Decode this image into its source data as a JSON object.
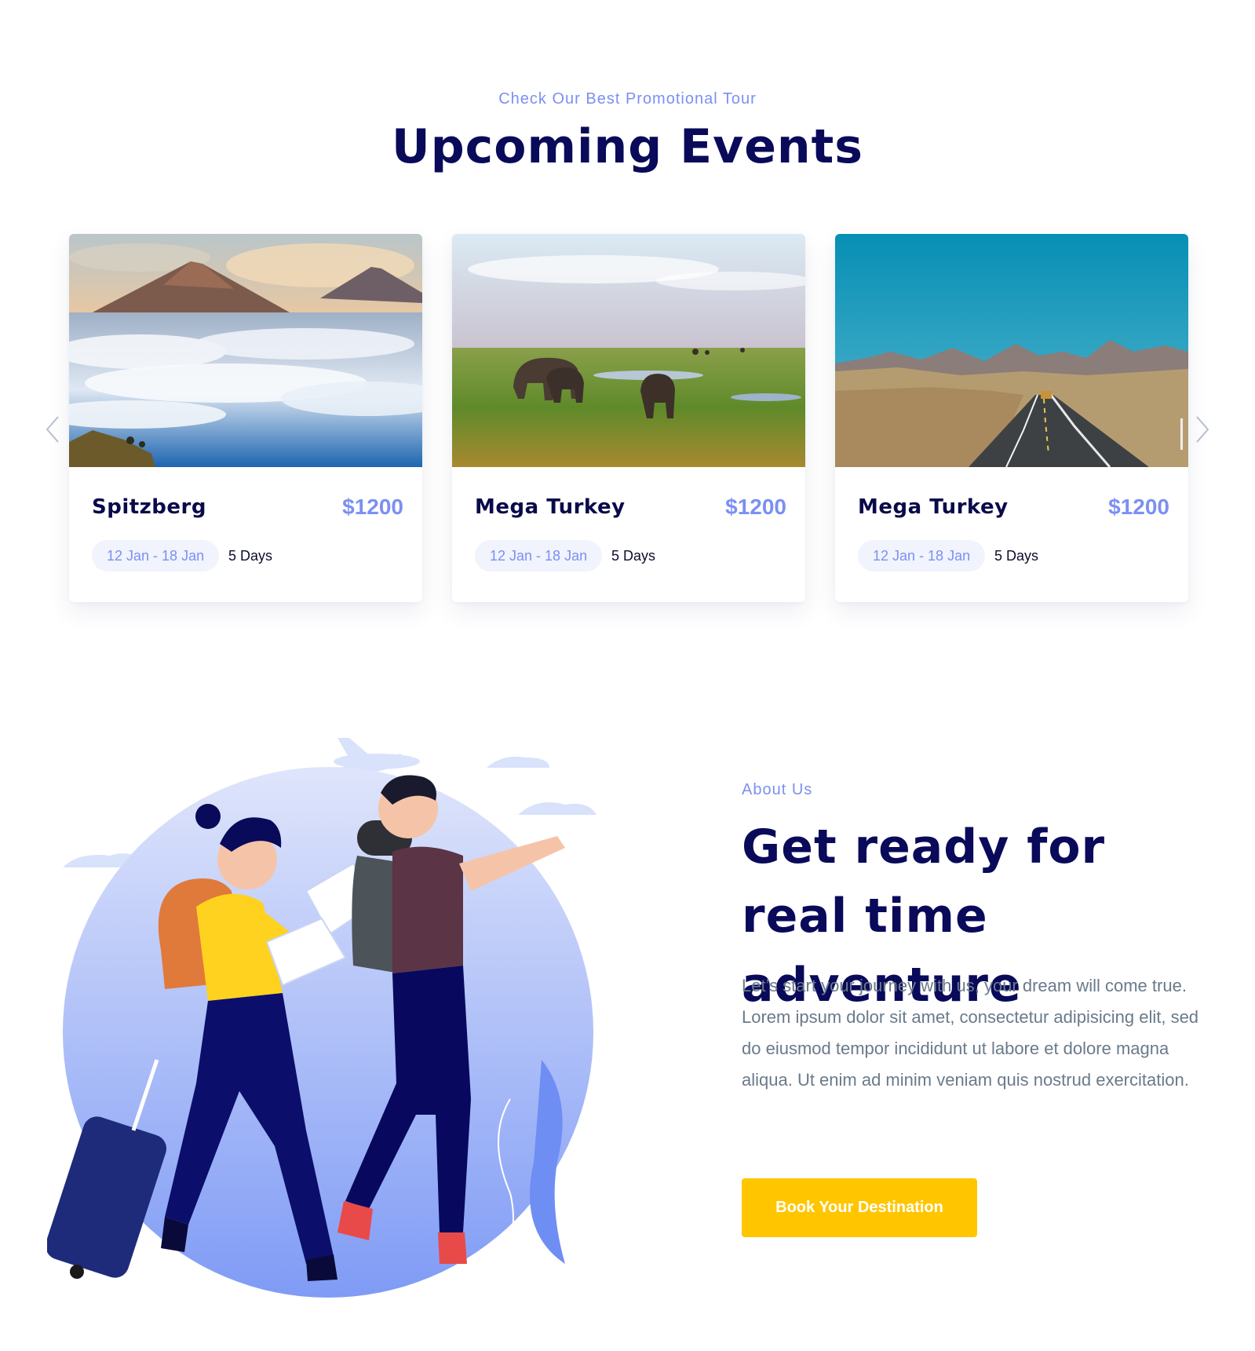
{
  "events": {
    "eyebrow": "Check Our Best Promotional Tour",
    "title": "Upcoming Events",
    "cards": [
      {
        "name": "Spitzberg",
        "price": "$1200",
        "dates": "12 Jan - 18 Jan",
        "duration": "5 Days",
        "image": "volcano-above-clouds"
      },
      {
        "name": "Mega Turkey",
        "price": "$1200",
        "dates": "12 Jan - 18 Jan",
        "duration": "5 Days",
        "image": "elephants-savanna"
      },
      {
        "name": "Mega Turkey",
        "price": "$1200",
        "dates": "12 Jan - 18 Jan",
        "duration": "5 Days",
        "image": "desert-road-mountains"
      }
    ],
    "prev_icon": "chevron-left-icon",
    "next_icon": "chevron-right-icon"
  },
  "about": {
    "eyebrow": "About Us",
    "title": "Get ready for real time adventure",
    "text": "Let’s start your journey with us, your dream will come true. Lorem ipsum dolor sit amet, consectetur adipisicing elit, sed do eiusmod tempor incididunt ut labore et dolore magna aliqua. Ut enim ad minim veniam quis nostrud exercitation.",
    "button_label": "Book Your Destination",
    "illustration": "travelers-illustration"
  },
  "colors": {
    "accent": "#7b90f2",
    "heading": "#0a0a5a",
    "button": "#ffc600",
    "body_text": "#6a7a8a",
    "pill_bg": "#f1f3fd"
  }
}
